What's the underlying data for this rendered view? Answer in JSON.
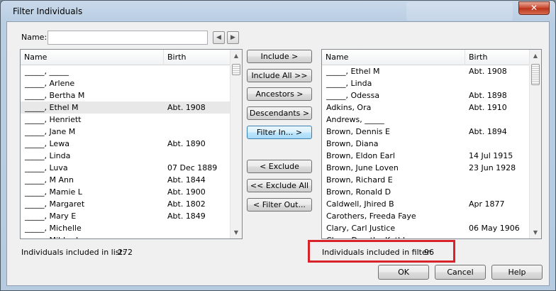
{
  "window": {
    "title": "Filter Individuals",
    "close_symbol": "✕"
  },
  "name_filter": {
    "label": "Name:",
    "value": "",
    "prev_symbol": "◀",
    "next_symbol": "▶"
  },
  "left_list": {
    "columns": [
      "Name",
      "Birth"
    ],
    "rows": [
      {
        "name": "_____, _____",
        "birth": ""
      },
      {
        "name": "_____, Arlene",
        "birth": ""
      },
      {
        "name": "_____, Bertha M",
        "birth": ""
      },
      {
        "name": "_____, Ethel M",
        "birth": "Abt. 1908",
        "selected": true
      },
      {
        "name": "_____, Henriett",
        "birth": ""
      },
      {
        "name": "_____, Jane M",
        "birth": ""
      },
      {
        "name": "_____, Lewa",
        "birth": "Abt. 1890"
      },
      {
        "name": "_____, Linda",
        "birth": ""
      },
      {
        "name": "_____, Luva",
        "birth": "07 Dec 1889"
      },
      {
        "name": "_____, M Ann",
        "birth": "Abt. 1844"
      },
      {
        "name": "_____, Mamie L",
        "birth": "Abt. 1900"
      },
      {
        "name": "_____, Margaret",
        "birth": "Abt. 1802"
      },
      {
        "name": "_____, Mary E",
        "birth": "Abt. 1849"
      },
      {
        "name": "_____, Michelle",
        "birth": ""
      },
      {
        "name": "_____, Mildred",
        "birth": ""
      }
    ]
  },
  "right_list": {
    "columns": [
      "Name",
      "Birth"
    ],
    "rows": [
      {
        "name": "_____, Ethel M",
        "birth": "Abt. 1908"
      },
      {
        "name": "_____, Linda",
        "birth": ""
      },
      {
        "name": "_____, Odessa",
        "birth": "Abt. 1898"
      },
      {
        "name": "Adkins, Ora",
        "birth": "Abt. 1910"
      },
      {
        "name": "Andrews, _____",
        "birth": ""
      },
      {
        "name": "Brown, Dennis E",
        "birth": "Abt. 1894"
      },
      {
        "name": "Brown, Diana",
        "birth": ""
      },
      {
        "name": "Brown, Eldon Earl",
        "birth": "14 Jul 1915"
      },
      {
        "name": "Brown, June Loven",
        "birth": "23 Jun 1928"
      },
      {
        "name": "Brown, Richard E",
        "birth": ""
      },
      {
        "name": "Brown, Ronald D",
        "birth": ""
      },
      {
        "name": "Caldwell, Jhired B",
        "birth": "Apr 1877"
      },
      {
        "name": "Carothers, Freeda Faye",
        "birth": ""
      },
      {
        "name": "Clary, Carl Justice",
        "birth": "06 May 1906"
      },
      {
        "name": "Clary, Dorothy Kathl",
        "birth": ""
      }
    ]
  },
  "buttons": {
    "include": "Include >",
    "include_all": "Include All  >>",
    "ancestors": "Ancestors >",
    "descendants": "Descendants >",
    "filter_in": "Filter In... >",
    "exclude": "< Exclude",
    "exclude_all": "<< Exclude All",
    "filter_out": "< Filter Out...",
    "ok": "OK",
    "cancel": "Cancel",
    "help": "Help"
  },
  "status": {
    "list_label": "Individuals included in list:",
    "list_count": "272",
    "filter_label": "Individuals included in filter:",
    "filter_count": "96"
  },
  "scroll_symbols": {
    "up": "▲",
    "down": "▼"
  },
  "colors": {
    "highlight_border": "#d9232b",
    "selected_row": "#e8e8e8"
  }
}
